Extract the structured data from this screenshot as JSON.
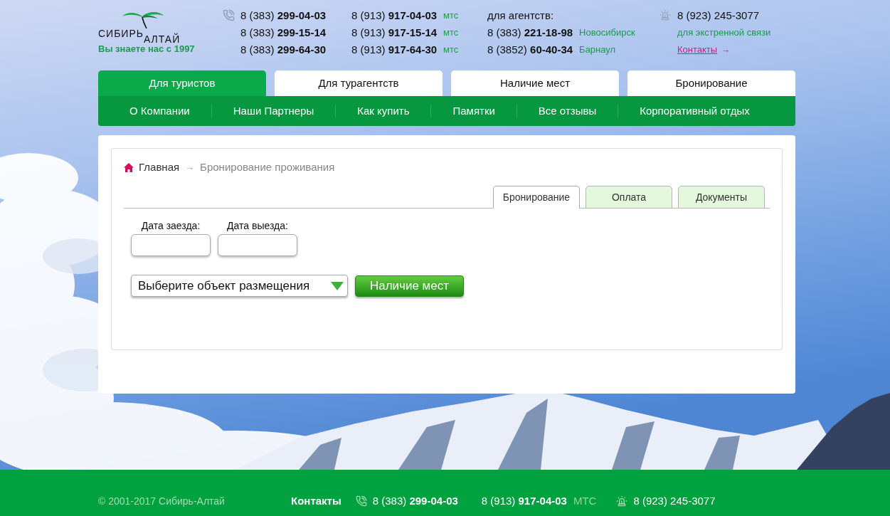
{
  "header": {
    "logo": {
      "wordmark": [
        "СИБИРЬ",
        "АЛТАЙ"
      ],
      "tagline": "Вы знаете нас с 1997"
    },
    "phone_columns": [
      {
        "rows": [
          {
            "phone": "8 (383) **299-04-03**"
          },
          {
            "phone": "8 (383) **299-15-14**"
          },
          {
            "phone": "8 (383) **299-64-30**"
          }
        ]
      },
      {
        "rows": [
          {
            "phone": "8 (913) **917-04-03**",
            "note": "мтс"
          },
          {
            "phone": "8 (913) **917-15-14**",
            "note": "мтс"
          },
          {
            "phone": "8 (913) **917-64-30**",
            "note": "мтс"
          }
        ]
      }
    ],
    "agencies": {
      "title": "для агентств:",
      "rows": [
        {
          "phone": "8 (383) **221-18-98**",
          "note": "Новосибирск"
        },
        {
          "phone": "8 (3852) **60-40-34**",
          "note": "Барнаул"
        }
      ]
    },
    "emergency": {
      "phone": "8 (923) 245-3077",
      "note": "для экстренной связи",
      "link": "Контакты",
      "arrow": "→"
    }
  },
  "tabs": [
    {
      "label": "Для туристов",
      "selected": true
    },
    {
      "label": "Для турагентств",
      "selected": false
    },
    {
      "label": "Наличие мест",
      "selected": false
    },
    {
      "label": "Бронирование",
      "selected": false
    }
  ],
  "menu": [
    "О Компании",
    "Наши Партнеры",
    "Как купить",
    "Памятки",
    "Все отзывы",
    "Корпоративный отдых"
  ],
  "content": {
    "breadcrumb": {
      "home": "Главная",
      "separator": "→",
      "current": "Бронирование проживания"
    },
    "tabs": [
      {
        "label": "Бронирование",
        "selected": true
      },
      {
        "label": "Оплата",
        "selected": false
      },
      {
        "label": "Документы",
        "selected": false
      }
    ],
    "date_fields": [
      {
        "label": "Дата заезда:"
      },
      {
        "label": "Дата выезда:"
      }
    ],
    "select": {
      "value": "Выберите объект размещения"
    },
    "button": "Наличие мест"
  },
  "footer": {
    "copyright": "© 2001-2017 Сибирь-Алтай",
    "contacts": "Контакты",
    "phones": [
      {
        "phone": "8 (383) **299-04-03**"
      },
      {
        "phone": "8 (913) **917-04-03**",
        "note": "МТС"
      }
    ],
    "emergency_phone": "8 (923) 245-3077"
  }
}
